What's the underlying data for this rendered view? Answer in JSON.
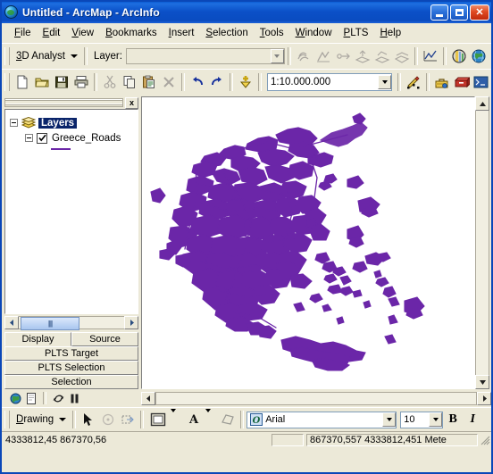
{
  "window": {
    "title": "Untitled - ArcMap - ArcInfo",
    "app_icon": "arcmap-globe-icon",
    "minimize_label": "Minimize",
    "maximize_label": "Maximize",
    "close_label": "Close"
  },
  "menubar": {
    "items": [
      {
        "label": "File",
        "accel": "F"
      },
      {
        "label": "Edit",
        "accel": "E"
      },
      {
        "label": "View",
        "accel": "V"
      },
      {
        "label": "Bookmarks",
        "accel": "B"
      },
      {
        "label": "Insert",
        "accel": "I"
      },
      {
        "label": "Selection",
        "accel": "S"
      },
      {
        "label": "Tools",
        "accel": "T"
      },
      {
        "label": "Window",
        "accel": "W"
      },
      {
        "label": "PLTS",
        "accel": "P"
      },
      {
        "label": "Help",
        "accel": "H"
      }
    ]
  },
  "analyst_toolbar": {
    "menu_label": "3D Analyst",
    "menu_accel": "3",
    "layer_label": "Layer:",
    "layer_value": "",
    "layer_placeholder": "",
    "buttons": [
      {
        "name": "contour-icon",
        "enabled": false
      },
      {
        "name": "steepest-path-icon",
        "enabled": false
      },
      {
        "name": "line-of-sight-icon",
        "enabled": false
      },
      {
        "name": "interpolate-line-icon",
        "enabled": false
      },
      {
        "name": "profile-area-icon",
        "enabled": false
      },
      {
        "name": "surface-area-icon",
        "enabled": false
      },
      {
        "name": "profile-graph-icon",
        "enabled": true
      },
      {
        "name": "arcscene-icon",
        "enabled": true
      },
      {
        "name": "arcglobe-icon",
        "enabled": true
      }
    ]
  },
  "standard_toolbar": {
    "scale_value": "1:10.000.000",
    "buttons": [
      {
        "name": "new-map-button",
        "label": "New",
        "enabled": true
      },
      {
        "name": "open-map-button",
        "label": "Open",
        "enabled": true
      },
      {
        "name": "save-map-button",
        "label": "Save",
        "enabled": true
      },
      {
        "name": "print-map-button",
        "label": "Print",
        "enabled": true
      },
      {
        "name": "cut-button",
        "label": "Cut",
        "enabled": false
      },
      {
        "name": "copy-button",
        "label": "Copy",
        "enabled": true
      },
      {
        "name": "paste-button",
        "label": "Paste",
        "enabled": true
      },
      {
        "name": "delete-button",
        "label": "Delete",
        "enabled": false
      },
      {
        "name": "undo-button",
        "label": "Undo",
        "enabled": true
      },
      {
        "name": "redo-button",
        "label": "Redo",
        "enabled": true
      },
      {
        "name": "add-data-button",
        "label": "Add Data",
        "enabled": true
      },
      {
        "name": "editor-toolbar-button",
        "label": "Editor Toolbar",
        "enabled": true
      },
      {
        "name": "arctoolbox-button",
        "label": "ArcToolbox",
        "enabled": true
      },
      {
        "name": "model-builder-button",
        "label": "ModelBuilder",
        "enabled": true
      },
      {
        "name": "python-window-button",
        "label": "Command Line",
        "enabled": true
      }
    ]
  },
  "toc": {
    "close_label": "x",
    "root": {
      "label": "Layers",
      "selected": true,
      "expanded": true
    },
    "layer": {
      "label": "Greece_Roads",
      "checked": true,
      "expanded": true,
      "symbol_color": "#6B26A8",
      "symbol_type": "line"
    },
    "tabs": [
      {
        "label": "Display",
        "active": true
      },
      {
        "label": "Source",
        "active": false
      },
      {
        "label": "PLTS Target",
        "active": false
      },
      {
        "label": "PLTS Selection",
        "active": false
      },
      {
        "label": "Selection",
        "active": false
      }
    ]
  },
  "viewbar": {
    "buttons": [
      {
        "name": "data-view-button",
        "label": "Data View",
        "active": true
      },
      {
        "name": "layout-view-button",
        "label": "Layout View",
        "active": false
      },
      {
        "name": "refresh-view-button",
        "label": "Refresh View",
        "active": false
      },
      {
        "name": "pause-drawing-button",
        "label": "Pause Drawing",
        "active": false
      }
    ]
  },
  "drawing_toolbar": {
    "menu_label": "Drawing",
    "menu_accel": "D",
    "font_name": "Arial",
    "font_size": "10",
    "bold_label": "B",
    "italic_label": "I",
    "buttons": [
      {
        "name": "select-elements-button",
        "label": "Select Elements",
        "enabled": true
      },
      {
        "name": "rotate-element-button",
        "label": "Rotate",
        "enabled": false
      },
      {
        "name": "new-rectangle-button",
        "label": "New Rectangle",
        "enabled": true
      },
      {
        "name": "fill-color-button",
        "label": "Fill Color",
        "enabled": true
      },
      {
        "name": "text-color-button",
        "label": "Font Color",
        "enabled": true
      },
      {
        "name": "nudge-button",
        "label": "Nudge",
        "enabled": false
      }
    ]
  },
  "statusbar": {
    "left_text": "4333812,45 867370,56",
    "coordinates": "867370,557  4333812,451 Mete",
    "units": "Meters"
  },
  "map": {
    "layer_name": "Greece_Roads",
    "road_color": "#6B26A8",
    "background": "#FFFFFF",
    "scale": "1:10.000.000"
  },
  "colors": {
    "title_blue": "#0A47B8",
    "chrome": "#ECE9D8",
    "selection_blue": "#0A246A",
    "purple": "#6B26A8"
  }
}
